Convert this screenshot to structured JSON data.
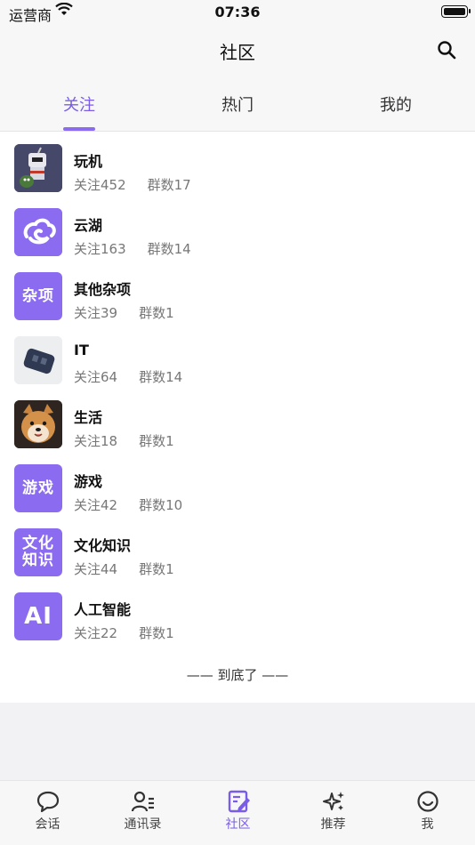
{
  "status_bar": {
    "carrier": "运营商",
    "time": "07:36"
  },
  "header": {
    "title": "社区",
    "search_icon": "search-icon"
  },
  "tabs": [
    {
      "label": "关注",
      "active": true
    },
    {
      "label": "热门",
      "active": false
    },
    {
      "label": "我的",
      "active": false
    }
  ],
  "communities": [
    {
      "name": "玩机",
      "followers": "关注452",
      "groups": "群数17",
      "avatar": "robot-image"
    },
    {
      "name": "云湖",
      "followers": "关注163",
      "groups": "群数14",
      "avatar": "cloud-logo"
    },
    {
      "name": "其他杂项",
      "followers": "关注39",
      "groups": "群数1",
      "avatar_text": "杂项"
    },
    {
      "name": "IT",
      "followers": "关注64",
      "groups": "群数14",
      "avatar": "device-image"
    },
    {
      "name": "生活",
      "followers": "关注18",
      "groups": "群数1",
      "avatar": "shiba-dog-image"
    },
    {
      "name": "游戏",
      "followers": "关注42",
      "groups": "群数10",
      "avatar_text": "游戏"
    },
    {
      "name": "文化知识",
      "followers": "关注44",
      "groups": "群数1",
      "avatar_text": "文化\n知识"
    },
    {
      "name": "人工智能",
      "followers": "关注22",
      "groups": "群数1",
      "avatar_text": "AI"
    }
  ],
  "list_end": "—— 到底了 ——",
  "bottom_nav": [
    {
      "label": "会话",
      "icon": "chat-bubble-icon",
      "active": false
    },
    {
      "label": "通讯录",
      "icon": "contacts-icon",
      "active": false
    },
    {
      "label": "社区",
      "icon": "community-edit-icon",
      "active": true
    },
    {
      "label": "推荐",
      "icon": "sparkle-icon",
      "active": false
    },
    {
      "label": "我",
      "icon": "smiley-icon",
      "active": false
    }
  ],
  "colors": {
    "accent": "#8b6cf0",
    "accent_text": "#7a5ce6",
    "background": "#f2f2f4"
  }
}
